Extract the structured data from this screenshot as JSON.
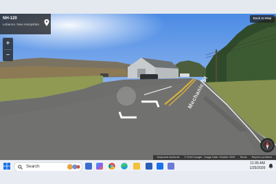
{
  "location": {
    "title": "NH-120",
    "subtitle": "Lebanon, New Hampshire"
  },
  "controls": {
    "back_label": "Back to Map",
    "zoom_in": "+",
    "zoom_out": "−"
  },
  "street_label": "Mechanic St",
  "footer": {
    "shortcuts": "Keyboard shortcuts",
    "copyright": "© 2026 Google · Image Date: October 2009",
    "terms": "Terms",
    "report": "Report a problem"
  },
  "taskbar": {
    "search_label": "Search",
    "time": "11:35 AM",
    "date": "1/25/2026",
    "apps": [
      "file-explorer-icon",
      "copilot-icon",
      "chrome-icon",
      "edge-icon",
      "folder-icon",
      "word-icon",
      "outlook-icon",
      "snipping-tool-icon"
    ]
  },
  "colors": {
    "sky_top": "#4f8fe6",
    "sky_bottom": "#c9dcf6",
    "road": "#6e6e6c",
    "grass": "#8f9b55",
    "ui_dark": "#222222"
  }
}
